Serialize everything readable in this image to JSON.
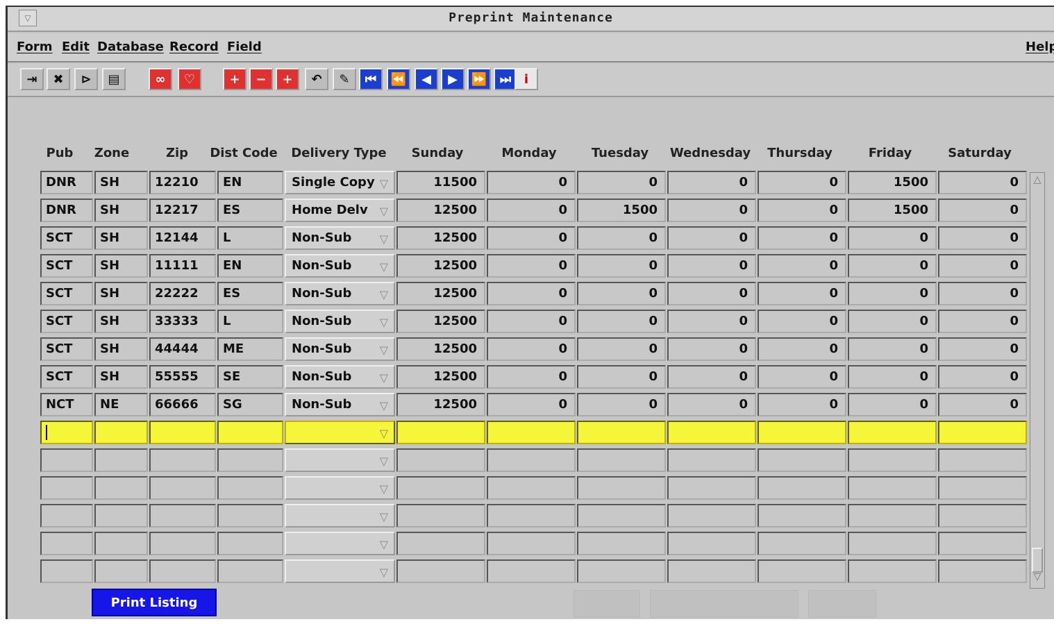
{
  "window": {
    "title": "Preprint Maintenance",
    "sysmenu_glyph": "▽"
  },
  "menubar": {
    "items": [
      "Form",
      "Edit",
      "Database",
      "Record",
      "Field"
    ],
    "help": "Help"
  },
  "toolbar": {
    "buttons": [
      {
        "icon": "exit-icon",
        "glyph": "⇥"
      },
      {
        "icon": "cancel-icon",
        "glyph": "✖"
      },
      {
        "icon": "enter-query-icon",
        "glyph": "⊳"
      },
      {
        "icon": "execute-query-icon",
        "glyph": "▤"
      },
      {
        "icon": "view-icon",
        "glyph": "∞"
      },
      {
        "icon": "count-icon",
        "glyph": "♡"
      },
      {
        "icon": "insert-record-icon",
        "glyph": "+"
      },
      {
        "icon": "delete-record-icon",
        "glyph": "−"
      },
      {
        "icon": "duplicate-record-icon",
        "glyph": "+"
      },
      {
        "icon": "clear-record-icon",
        "glyph": "↶"
      },
      {
        "icon": "edit-icon",
        "glyph": "✎"
      },
      {
        "icon": "first-record-icon",
        "glyph": "⏮"
      },
      {
        "icon": "previous-set-icon",
        "glyph": "⏪"
      },
      {
        "icon": "previous-record-icon",
        "glyph": "◀"
      },
      {
        "icon": "next-record-icon",
        "glyph": "▶"
      },
      {
        "icon": "next-set-icon",
        "glyph": "⏩"
      },
      {
        "icon": "last-record-icon",
        "glyph": "⏭"
      },
      {
        "icon": "info-icon",
        "glyph": "i"
      }
    ]
  },
  "grid": {
    "columns": [
      "Pub",
      "Zone",
      "Zip",
      "Dist Code",
      "Delivery Type",
      "Sunday",
      "Monday",
      "Tuesday",
      "Wednesday",
      "Thursday",
      "Friday",
      "Saturday"
    ],
    "dropdown_glyph": "▽",
    "rows": [
      {
        "pub": "DNR",
        "zone": "SH",
        "zip": "12210",
        "dist": "EN",
        "type": "Single Copy",
        "days": [
          "11500",
          "0",
          "0",
          "0",
          "0",
          "1500",
          "0"
        ]
      },
      {
        "pub": "DNR",
        "zone": "SH",
        "zip": "12217",
        "dist": "ES",
        "type": "Home Delv",
        "days": [
          "12500",
          "0",
          "1500",
          "0",
          "0",
          "1500",
          "0"
        ]
      },
      {
        "pub": "SCT",
        "zone": "SH",
        "zip": "12144",
        "dist": "L",
        "type": "Non-Sub",
        "days": [
          "12500",
          "0",
          "0",
          "0",
          "0",
          "0",
          "0"
        ]
      },
      {
        "pub": "SCT",
        "zone": "SH",
        "zip": "11111",
        "dist": "EN",
        "type": "Non-Sub",
        "days": [
          "12500",
          "0",
          "0",
          "0",
          "0",
          "0",
          "0"
        ]
      },
      {
        "pub": "SCT",
        "zone": "SH",
        "zip": "22222",
        "dist": "ES",
        "type": "Non-Sub",
        "days": [
          "12500",
          "0",
          "0",
          "0",
          "0",
          "0",
          "0"
        ]
      },
      {
        "pub": "SCT",
        "zone": "SH",
        "zip": "33333",
        "dist": "L",
        "type": "Non-Sub",
        "days": [
          "12500",
          "0",
          "0",
          "0",
          "0",
          "0",
          "0"
        ]
      },
      {
        "pub": "SCT",
        "zone": "SH",
        "zip": "44444",
        "dist": "ME",
        "type": "Non-Sub",
        "days": [
          "12500",
          "0",
          "0",
          "0",
          "0",
          "0",
          "0"
        ]
      },
      {
        "pub": "SCT",
        "zone": "SH",
        "zip": "55555",
        "dist": "SE",
        "type": "Non-Sub",
        "days": [
          "12500",
          "0",
          "0",
          "0",
          "0",
          "0",
          "0"
        ]
      },
      {
        "pub": "NCT",
        "zone": "NE",
        "zip": "66666",
        "dist": "SG",
        "type": "Non-Sub",
        "days": [
          "12500",
          "0",
          "0",
          "0",
          "0",
          "0",
          "0"
        ]
      }
    ],
    "current_row_color": "#f5f53a"
  },
  "scrollbar": {
    "up_glyph": "△",
    "down_glyph": "▽"
  },
  "footer": {
    "print_button": "Print Listing",
    "print_button_color": "#1616e8"
  }
}
